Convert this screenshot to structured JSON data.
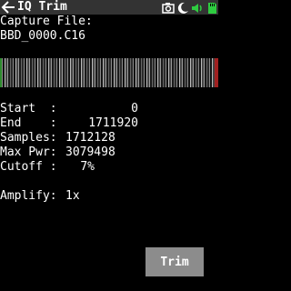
{
  "header": {
    "title": "IQ Trim",
    "back_icon": "arrow-left-icon",
    "status_icons": [
      "camera-icon",
      "moon-icon",
      "speaker-icon",
      "sd-card-icon"
    ],
    "status_colors": {
      "camera": "#ffffff",
      "moon": "#ffffff",
      "speaker": "#2ecc40",
      "sd": "#2ecc40"
    }
  },
  "capture": {
    "label": "Capture File:",
    "filename": "BBD_0000.C16"
  },
  "waterfall": {
    "left_marker_color": "#2e8b2e",
    "right_marker_color": "#a02020"
  },
  "fields": {
    "start_label": "Start  :",
    "start_value": "0",
    "end_label": "End    :",
    "end_value": "1711920",
    "samples_label": "Samples:",
    "samples_value": "1712128",
    "maxpwr_label": "Max Pwr:",
    "maxpwr_value": "3079498",
    "cutoff_label": "Cutoff :",
    "cutoff_value": "7%",
    "amplify_label": "Amplify:",
    "amplify_value": "1x"
  },
  "actions": {
    "trim_label": "Trim"
  }
}
